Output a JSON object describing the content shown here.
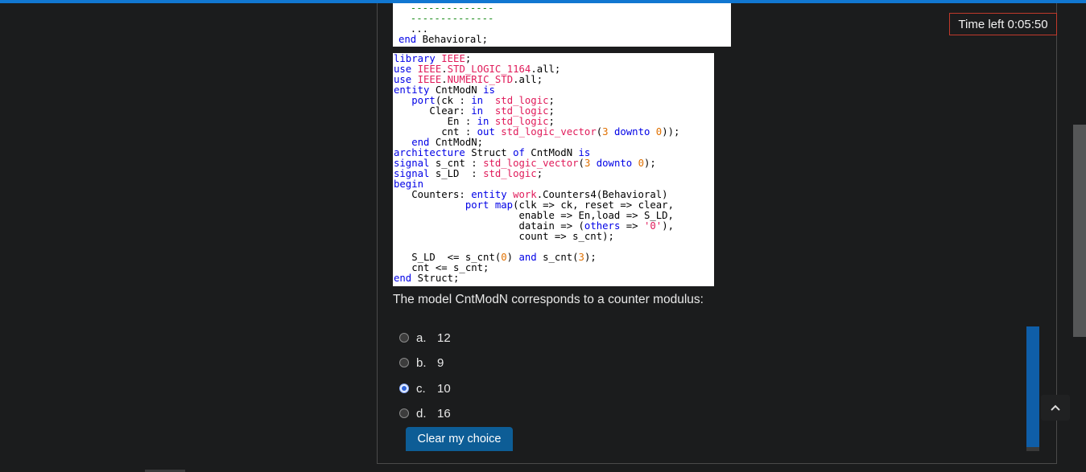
{
  "timer": {
    "label": "Time left 0:05:50"
  },
  "code_snippet_top": {
    "lines": [
      "  --------------",
      "  --------------",
      "  ...",
      "end Behavioral;"
    ]
  },
  "code_snippet_main": {
    "lines": [
      "library IEEE;",
      "use IEEE.STD_LOGIC_1164.all;",
      "use IEEE.NUMERIC_STD.all;",
      "entity CntModN is",
      "   port(ck : in  std_logic;",
      "      Clear: in  std_logic;",
      "         En : in std_logic;",
      "        cnt : out std_logic_vector(3 downto 0));",
      "   end CntModN;",
      "architecture Struct of CntModN is",
      "signal s_cnt : std_logic_vector(3 downto 0);",
      "signal s_LD  : std_logic;",
      "begin",
      "   Counters: entity work.Counters4(Behavioral)",
      "            port map(clk => ck, reset => clear,",
      "                     enable => En,load => S_LD,",
      "                     datain => (others => '0'),",
      "                     count => s_cnt);",
      "",
      "   S_LD  <= s_cnt(0) and s_cnt(3);",
      "   cnt <= s_cnt;",
      "end Struct;"
    ]
  },
  "question": {
    "text": "The model CntModN corresponds to a counter modulus:"
  },
  "options": [
    {
      "letter": "a.",
      "value": "12",
      "selected": false
    },
    {
      "letter": "b.",
      "value": "9",
      "selected": false
    },
    {
      "letter": "c.",
      "value": "10",
      "selected": true
    },
    {
      "letter": "d.",
      "value": "16",
      "selected": false
    }
  ],
  "clear_button": {
    "label": "Clear my choice"
  },
  "icons": {
    "scroll_top": "chevron-up-icon"
  },
  "colors": {
    "accent": "#1177d1",
    "button": "#0d5d96",
    "timer_border": "#c0392b"
  }
}
